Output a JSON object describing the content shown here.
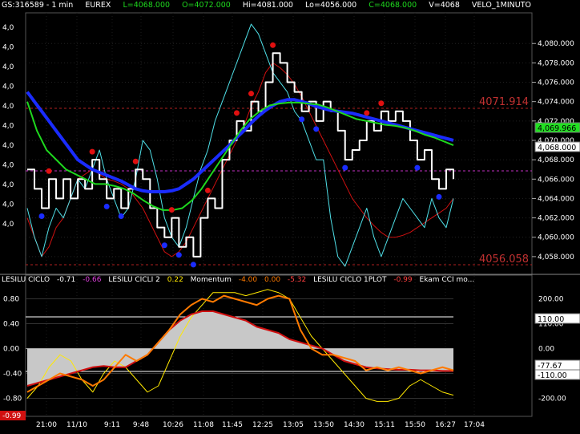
{
  "header": {
    "symbol": "GS:316589 - 1 min",
    "exchange": "EUREX",
    "low": "L=4068.000",
    "open": "O=4072.000",
    "high": "Hi=4081.000",
    "lo": "Lo=4056.000",
    "close": "C=4068.000",
    "volume": "V=4068",
    "study": "VELO_1MINUTO"
  },
  "indicators": {
    "ciclo_label": "LESILU CICLO",
    "ciclo_v1": "-0.71",
    "ciclo_v2": "-0.66",
    "cicli2_label": "LESILU CICLI 2",
    "cicli2_v": "0.22",
    "momentum_label": "Momentum",
    "momentum_v1": "-4.00",
    "momentum_v2": "0.00",
    "momentum_v3": "-5.32",
    "plot_label": "LESILU CICLO 1PLOT",
    "plot_v": "-0.99",
    "cci_label": "Ekam CCI mo..."
  },
  "levels": {
    "upper": "4071.914",
    "lower": "4056.058",
    "current_badge": "4,068.000",
    "green_badge": "4,069.966"
  },
  "bottom_badges": {
    "left": "-0.99",
    "r1": "110.00",
    "r2": "-77.67",
    "r3": "-110.00"
  },
  "colors": {
    "bg": "#000000",
    "price": "#ffffff",
    "cyan": "#4fe0e8",
    "blue": "#1a2cff",
    "green": "#1ed81e",
    "red": "#d01010",
    "orange": "#ff7a00",
    "yellow": "#ffe800",
    "magenta": "#e040e0"
  },
  "chart_data": [
    {
      "type": "line",
      "name": "price",
      "ylim": [
        4056.5,
        4083
      ],
      "y_ticks": [
        "4,080.000",
        "4,078.000",
        "4,076.000",
        "4,074.000",
        "4,072.000",
        "4,070.000",
        "4,068.000",
        "4,066.000",
        "4,064.000",
        "4,062.000",
        "4,060.000",
        "4,058.000"
      ],
      "y_tick_values": [
        4080,
        4078,
        4076,
        4074,
        4072,
        4070,
        4068,
        4066,
        4064,
        4062,
        4060,
        4058
      ],
      "left_ticks": [
        "4,0",
        "4,0",
        "4,0",
        "4,0",
        "4,0",
        "4,0",
        "4,0",
        "4,0",
        "4,0",
        "4,0",
        "4,0"
      ],
      "x_labels": [
        "21:00",
        "11/10",
        "9:11",
        "9:48",
        "10:26",
        "11:08",
        "11:45",
        "12:25",
        "13:05",
        "13:50",
        "14:30",
        "15:11",
        "15:50",
        "16:27",
        "17:04"
      ],
      "x_label_pos": [
        0.06,
        0.155,
        0.265,
        0.355,
        0.455,
        0.55,
        0.64,
        0.735,
        0.83,
        0.925,
        1.02,
        1.115,
        1.21,
        1.305,
        1.395
      ],
      "series": [
        {
          "name": "price",
          "values": [
            4067,
            4065,
            4063,
            4066,
            4064,
            4066,
            4064,
            4066,
            4065,
            4068,
            4066,
            4064,
            4065,
            4063,
            4065,
            4067,
            4066,
            4063,
            4061,
            4060,
            4062,
            4059,
            4060,
            4058,
            4062,
            4064,
            4063,
            4068,
            4070,
            4072,
            4071,
            4074,
            4073,
            4076,
            4079,
            4078,
            4076,
            4075,
            4073,
            4074,
            4072,
            4074,
            4073,
            4071,
            4068,
            4069,
            4070,
            4072,
            4071,
            4073,
            4072,
            4073,
            4072,
            4070,
            4068,
            4069,
            4066,
            4065,
            4067,
            4066
          ]
        },
        {
          "name": "fast",
          "values": [
            4063,
            4060,
            4058,
            4061,
            4063,
            4062,
            4064,
            4066,
            4065,
            4067,
            4069,
            4066,
            4064,
            4062,
            4063,
            4066,
            4070,
            4069,
            4066,
            4062,
            4060,
            4059,
            4061,
            4064,
            4067,
            4069,
            4072,
            4074,
            4076,
            4078,
            4080,
            4082,
            4081,
            4079,
            4077,
            4076,
            4075,
            4073,
            4072,
            4070,
            4068,
            4068,
            4062,
            4058,
            4057,
            4059,
            4061,
            4063,
            4060,
            4058,
            4060,
            4062,
            4064,
            4063,
            4062,
            4061,
            4064,
            4062,
            4061,
            4064
          ]
        },
        {
          "name": "ma_blue",
          "values": [
            4075,
            4074,
            4073,
            4072,
            4071,
            4070,
            4069,
            4068,
            4067.5,
            4067,
            4066.7,
            4066.4,
            4066.1,
            4065.8,
            4065.4,
            4065,
            4064.8,
            4064.7,
            4064.7,
            4064.7,
            4064.8,
            4065,
            4065.5,
            4066,
            4066.7,
            4067.4,
            4068.1,
            4068.8,
            4069.5,
            4070.3,
            4071,
            4071.8,
            4072.5,
            4073.1,
            4073.6,
            4074,
            4074.2,
            4074.2,
            4074,
            4073.8,
            4073.5,
            4073.3,
            4073.1,
            4073,
            4072.9,
            4072.8,
            4072.6,
            4072.4,
            4072.2,
            4072,
            4071.8,
            4071.6,
            4071.4,
            4071.2,
            4071,
            4070.8,
            4070.6,
            4070.4,
            4070.2,
            4070
          ]
        },
        {
          "name": "ma_green",
          "values": [
            4074,
            4071,
            4069,
            4068,
            4067,
            4066.5,
            4066,
            4065.5,
            4065.5,
            4065.3,
            4065,
            4064.5,
            4063.8,
            4063.2,
            4062.8,
            4062.8,
            4063,
            4063.8,
            4065,
            4066.5,
            4068,
            4069.5,
            4071,
            4072.2,
            4073,
            4073.6,
            4073.8,
            4073.9,
            4073.9,
            4073.8,
            4073.7,
            4073.4,
            4073,
            4072.6,
            4072.2,
            4072,
            4071.8,
            4071.6,
            4071.5,
            4071.3,
            4071,
            4070.6,
            4070.3,
            4069.9,
            4069.5
          ]
        },
        {
          "name": "red_env",
          "values": [
            4062,
            4060,
            4058,
            4059,
            4061,
            4062,
            4064,
            4066,
            4066.5,
            4067,
            4066.5,
            4066,
            4065.8,
            4065.5,
            4065,
            4064,
            4063,
            4061.5,
            4060,
            4058.5,
            4058,
            4058.5,
            4059.5,
            4061,
            4062.5,
            4064,
            4065.5,
            4067,
            4068.5,
            4070,
            4071.5,
            4073.5,
            4075,
            4077,
            4078,
            4077.5,
            4076.8,
            4075.8,
            4074.5,
            4073,
            4071.5,
            4070,
            4068.5,
            4067,
            4065.5,
            4064,
            4063,
            4062,
            4061.2,
            4060.5,
            4060,
            4060,
            4060.2,
            4060.5,
            4061,
            4061.5,
            4062,
            4062.5,
            4063,
            4064
          ]
        }
      ]
    },
    {
      "type": "line",
      "name": "oscillators",
      "ylim": [
        -1.0,
        1.0
      ],
      "y_ticks": [
        "0.80",
        "0.40",
        "0.00",
        "-0.40",
        "-0.80"
      ],
      "y_tick_values": [
        0.8,
        0.4,
        0.0,
        -0.4,
        -0.8
      ],
      "y_ticks_right": [
        "200.00",
        "110.00",
        "0.00",
        "-110.00",
        "-200.00"
      ],
      "series": [
        {
          "name": "cicli2",
          "values": [
            -0.8,
            -0.6,
            -0.3,
            -0.1,
            -0.2,
            -0.5,
            -0.7,
            -0.4,
            -0.2,
            -0.3,
            -0.5,
            -0.7,
            -0.6,
            -0.2,
            0.2,
            0.5,
            0.7,
            0.9,
            0.9,
            0.9,
            0.85,
            0.9,
            0.95,
            0.9,
            0.8,
            0.5,
            0.2,
            0.0,
            -0.2,
            -0.4,
            -0.6,
            -0.8,
            -0.85,
            -0.85,
            -0.8,
            -0.6,
            -0.5,
            -0.6,
            -0.7,
            -0.75
          ]
        },
        {
          "name": "momentum",
          "values": [
            -0.6,
            -0.55,
            -0.5,
            -0.45,
            -0.4,
            -0.35,
            -0.3,
            -0.28,
            -0.3,
            -0.3,
            -0.2,
            -0.1,
            0.1,
            0.3,
            0.45,
            0.55,
            0.6,
            0.6,
            0.55,
            0.5,
            0.45,
            0.35,
            0.3,
            0.25,
            0.15,
            0.1,
            0.05,
            0.0,
            -0.1,
            -0.2,
            -0.25,
            -0.3,
            -0.32,
            -0.33,
            -0.34,
            -0.34,
            -0.35,
            -0.35,
            -0.36,
            -0.36
          ]
        },
        {
          "name": "plot1",
          "values": [
            -0.7,
            -0.6,
            -0.5,
            -0.4,
            -0.45,
            -0.5,
            -0.6,
            -0.5,
            -0.3,
            -0.1,
            -0.2,
            -0.1,
            0.1,
            0.3,
            0.55,
            0.7,
            0.8,
            0.75,
            0.85,
            0.8,
            0.75,
            0.7,
            0.8,
            0.85,
            0.8,
            0.3,
            0.0,
            -0.1,
            -0.1,
            -0.15,
            -0.2,
            -0.35,
            -0.3,
            -0.35,
            -0.3,
            -0.35,
            -0.4,
            -0.35,
            -0.3,
            -0.35
          ]
        }
      ]
    }
  ]
}
